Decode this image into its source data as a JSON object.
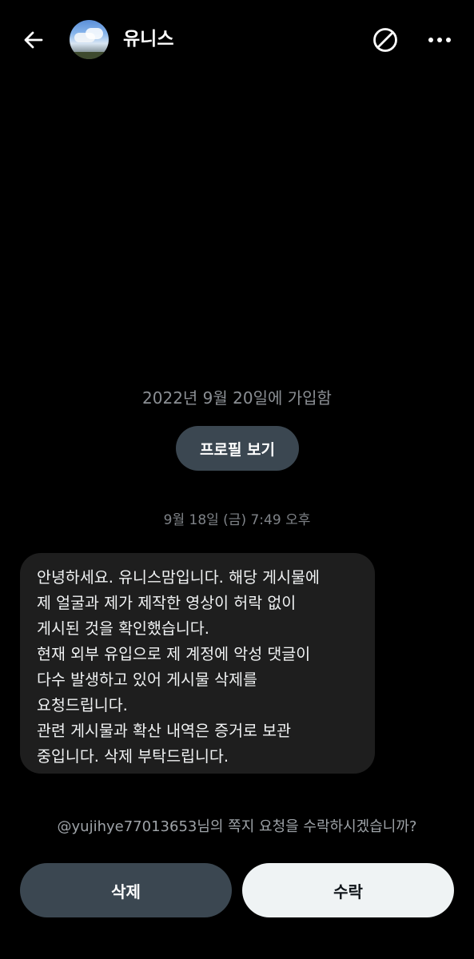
{
  "header": {
    "title": "유니스",
    "back_icon": "arrow-left-icon",
    "block_icon": "block-icon",
    "more_icon": "more-horizontal-icon"
  },
  "profile": {
    "joined_text": "2022년 9월 20일에 가입함",
    "view_profile_label": "프로필 보기"
  },
  "conversation": {
    "timestamp": "9월 18일 (금) 7:49 오후",
    "message_lines": [
      "안녕하세요. 유니스맘입니다. 해당 게시물에",
      "제 얼굴과 제가 제작한 영상이 허락 없이",
      "게시된 것을 확인했습니다.",
      "현재 외부 유입으로 제 계정에 악성 댓글이",
      "다수 발생하고 있어 게시물 삭제를",
      "요청드립니다.",
      "관련 게시물과 확산 내역은 증거로 보관",
      "중입니다. 삭제 부탁드립니다."
    ]
  },
  "request": {
    "prompt": "@yujihye77013653님의 쪽지 요청을 수락하시겠습니까?",
    "delete_label": "삭제",
    "accept_label": "수락"
  },
  "colors": {
    "background": "#000000",
    "bubble": "#1e1e1e",
    "secondary_button": "#3b4751",
    "primary_button": "#eff3f4"
  }
}
